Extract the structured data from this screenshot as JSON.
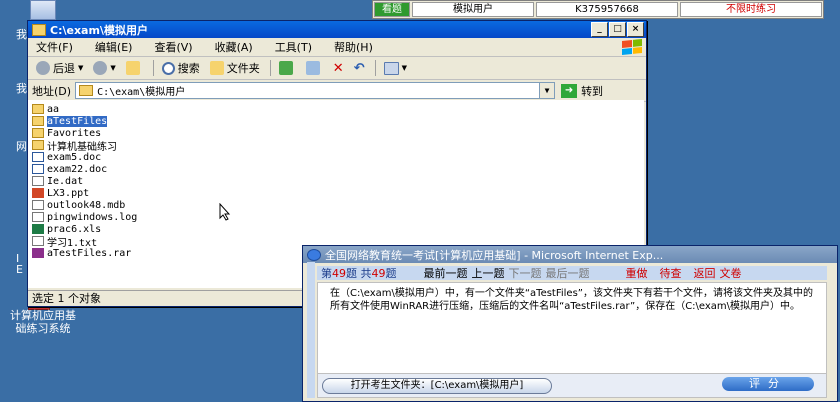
{
  "desktop": {
    "icon_label_line1": "计算机应用基",
    "icon_label_line2": "础练习系统",
    "frag1": "我",
    "frag2": "我",
    "frag3": "网",
    "frag4": "I",
    "frag5": "E"
  },
  "status_bar": {
    "view": "看题",
    "mode": "模拟用户",
    "id": "K375957668",
    "unlimited": "不限时练习"
  },
  "explorer": {
    "title": "C:\\exam\\模拟用户",
    "menu": [
      "文件(F)",
      "编辑(E)",
      "查看(V)",
      "收藏(A)",
      "工具(T)",
      "帮助(H)"
    ],
    "toolbar": {
      "back": "后退",
      "search": "搜索",
      "folders": "文件夹"
    },
    "address": {
      "label": "地址(D)",
      "value": "C:\\exam\\模拟用户",
      "go": "转到"
    },
    "files": [
      {
        "name": "aa",
        "type": "folder"
      },
      {
        "name": "aTestFiles",
        "type": "folder"
      },
      {
        "name": "Favorites",
        "type": "folder"
      },
      {
        "name": "计算机基础练习",
        "type": "folder"
      },
      {
        "name": "exam5.doc",
        "type": "doc"
      },
      {
        "name": "exam22.doc",
        "type": "doc"
      },
      {
        "name": "Ie.dat",
        "type": "generic"
      },
      {
        "name": "LX3.ppt",
        "type": "ppt"
      },
      {
        "name": "outlook48.mdb",
        "type": "generic"
      },
      {
        "name": "pingwindows.log",
        "type": "generic"
      },
      {
        "name": "prac6.xls",
        "type": "xls"
      },
      {
        "name": "学习1.txt",
        "type": "generic"
      },
      {
        "name": "aTestFiles.rar",
        "type": "rar"
      }
    ],
    "status": "选定 1 个对象"
  },
  "exam": {
    "title": "全国网络教育统一考试[计算机应用基础] - Microsoft Internet Exp...",
    "q_prefix": "第",
    "q_num": "49",
    "q_mid": "题 共",
    "q_total": "49",
    "q_suffix": "题",
    "nav_first": "最前一题",
    "nav_prev": "上一题",
    "nav_next": "下一题",
    "nav_last": "最后一题",
    "redo": "重做",
    "pending": "待查",
    "back": "返回",
    "doc": "文卷",
    "question": "在（C:\\exam\\模拟用户）中，有一个文件夹“aTestFiles”，该文件夹下有若干个文件，请将该文件夹及其中的所有文件使用WinRAR进行压缩，压缩后的文件名叫“aTestFiles.rar”，保存在（C:\\exam\\模拟用户）中。",
    "open_folder": "打开考生文件夹：[C:\\exam\\模拟用户]",
    "score": "评分"
  }
}
